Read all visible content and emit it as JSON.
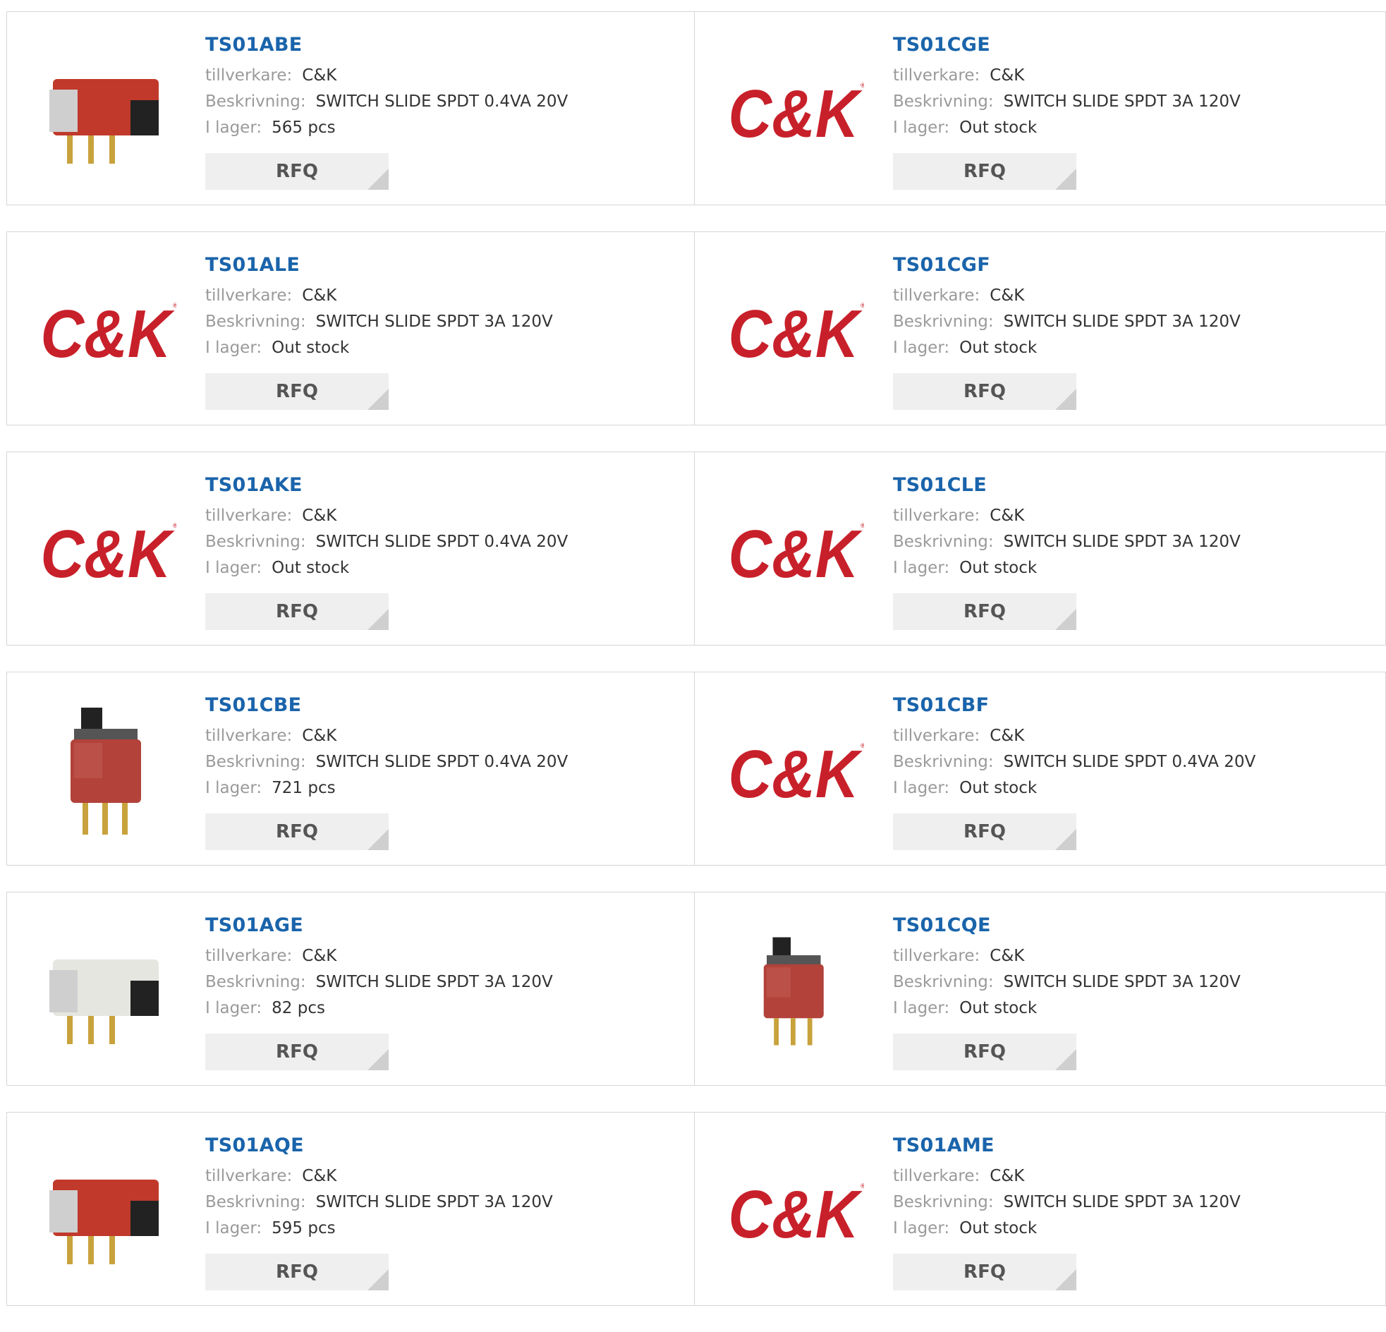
{
  "labels": {
    "manufacturer": "tillverkare:",
    "description": "Beskrivning:",
    "stock": "I lager:",
    "rfq": "RFQ"
  },
  "logo": {
    "text": "C&K",
    "registered": "®",
    "color": "#c8202a"
  },
  "products": [
    {
      "part": "TS01ABE",
      "manufacturer": "C&K",
      "description": "SWITCH SLIDE SPDT 0.4VA 20V",
      "stock": "565 pcs",
      "image": "side-switch-red"
    },
    {
      "part": "TS01CGE",
      "manufacturer": "C&K",
      "description": "SWITCH SLIDE SPDT 3A 120V",
      "stock": "Out stock",
      "image": "ck-logo"
    },
    {
      "part": "TS01ALE",
      "manufacturer": "C&K",
      "description": "SWITCH SLIDE SPDT 3A 120V",
      "stock": "Out stock",
      "image": "ck-logo"
    },
    {
      "part": "TS01CGF",
      "manufacturer": "C&K",
      "description": "SWITCH SLIDE SPDT 3A 120V",
      "stock": "Out stock",
      "image": "ck-logo"
    },
    {
      "part": "TS01AKE",
      "manufacturer": "C&K",
      "description": "SWITCH SLIDE SPDT 0.4VA 20V",
      "stock": "Out stock",
      "image": "ck-logo"
    },
    {
      "part": "TS01CLE",
      "manufacturer": "C&K",
      "description": "SWITCH SLIDE SPDT 3A 120V",
      "stock": "Out stock",
      "image": "ck-logo"
    },
    {
      "part": "TS01CBE",
      "manufacturer": "C&K",
      "description": "SWITCH SLIDE SPDT 0.4VA 20V",
      "stock": "721 pcs",
      "image": "vertical-switch"
    },
    {
      "part": "TS01CBF",
      "manufacturer": "C&K",
      "description": "SWITCH SLIDE SPDT 0.4VA 20V",
      "stock": "Out stock",
      "image": "ck-logo"
    },
    {
      "part": "TS01AGE",
      "manufacturer": "C&K",
      "description": "SWITCH SLIDE SPDT 3A 120V",
      "stock": "82 pcs",
      "image": "side-switch-white"
    },
    {
      "part": "TS01CQE",
      "manufacturer": "C&K",
      "description": "SWITCH SLIDE SPDT 3A 120V",
      "stock": "Out stock",
      "image": "vertical-switch-small"
    },
    {
      "part": "TS01AQE",
      "manufacturer": "C&K",
      "description": "SWITCH SLIDE SPDT 3A 120V",
      "stock": "595 pcs",
      "image": "side-switch-red-2"
    },
    {
      "part": "TS01AME",
      "manufacturer": "C&K",
      "description": "SWITCH SLIDE SPDT 3A 120V",
      "stock": "Out stock",
      "image": "ck-logo"
    }
  ]
}
